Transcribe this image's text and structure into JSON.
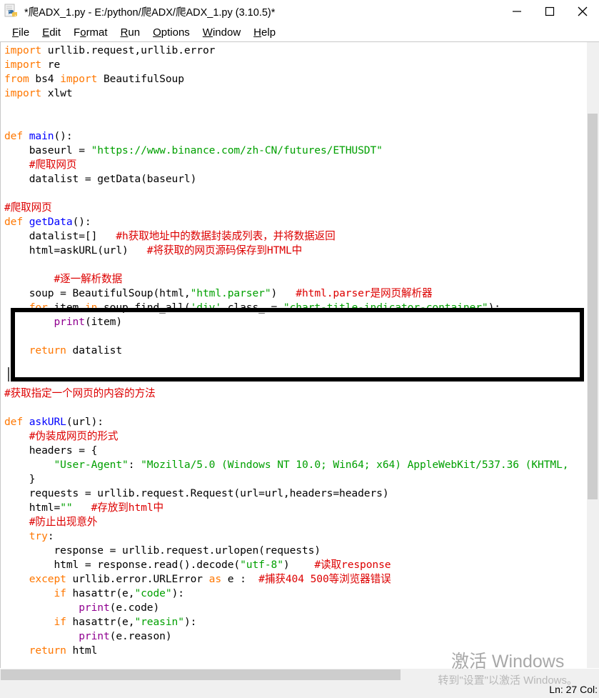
{
  "window": {
    "title": "*爬ADX_1.py - E:/python/爬ADX/爬ADX_1.py (3.10.5)*",
    "icon": "python-file-icon",
    "controls": {
      "minimize": "—",
      "maximize": "□",
      "close": "✕"
    }
  },
  "menubar": {
    "items": [
      {
        "mnemonic": "F",
        "rest": "ile"
      },
      {
        "mnemonic": "E",
        "rest": "dit"
      },
      {
        "pre": "F",
        "mnemonic": "o",
        "rest": "rmat"
      },
      {
        "mnemonic": "R",
        "rest": "un"
      },
      {
        "mnemonic": "O",
        "rest": "ptions"
      },
      {
        "mnemonic": "W",
        "rest": "indow"
      },
      {
        "mnemonic": "H",
        "rest": "elp"
      }
    ]
  },
  "editor": {
    "lines": [
      [
        {
          "t": "import",
          "c": "kw"
        },
        {
          "t": " urllib.request,urllib.error",
          "c": "pl"
        }
      ],
      [
        {
          "t": "import",
          "c": "kw"
        },
        {
          "t": " re",
          "c": "pl"
        }
      ],
      [
        {
          "t": "from",
          "c": "kw"
        },
        {
          "t": " bs4 ",
          "c": "pl"
        },
        {
          "t": "import",
          "c": "kw"
        },
        {
          "t": " BeautifulSoup",
          "c": "pl"
        }
      ],
      [
        {
          "t": "import",
          "c": "kw"
        },
        {
          "t": " xlwt",
          "c": "pl"
        }
      ],
      [],
      [],
      [
        {
          "t": "def",
          "c": "kw"
        },
        {
          "t": " ",
          "c": "pl"
        },
        {
          "t": "main",
          "c": "fn"
        },
        {
          "t": "():",
          "c": "pl"
        }
      ],
      [
        {
          "t": "    baseurl = ",
          "c": "pl"
        },
        {
          "t": "\"https://www.binance.com/zh-CN/futures/ETHUSDT\"",
          "c": "str"
        }
      ],
      [
        {
          "t": "    ",
          "c": "pl"
        },
        {
          "t": "#爬取网页",
          "c": "cmt"
        }
      ],
      [
        {
          "t": "    datalist = getData(baseurl)",
          "c": "pl"
        }
      ],
      [],
      [
        {
          "t": "#爬取网页",
          "c": "cmt"
        }
      ],
      [
        {
          "t": "def",
          "c": "kw"
        },
        {
          "t": " ",
          "c": "pl"
        },
        {
          "t": "getData",
          "c": "fn"
        },
        {
          "t": "():",
          "c": "pl"
        }
      ],
      [
        {
          "t": "    datalist=[]   ",
          "c": "pl"
        },
        {
          "t": "#h获取地址中的数据封装成列表，并将数据返回",
          "c": "cmt"
        }
      ],
      [
        {
          "t": "    html=askURL(url)   ",
          "c": "pl"
        },
        {
          "t": "#将获取的网页源码保存到HTML中",
          "c": "cmt"
        }
      ],
      [],
      [
        {
          "t": "        ",
          "c": "pl"
        },
        {
          "t": "#逐一解析数据",
          "c": "cmt"
        }
      ],
      [
        {
          "t": "    soup = BeautifulSoup(html,",
          "c": "pl"
        },
        {
          "t": "\"html.parser\"",
          "c": "str"
        },
        {
          "t": ")   ",
          "c": "pl"
        },
        {
          "t": "#html.parser是网页解析器",
          "c": "cmt"
        }
      ],
      [
        {
          "t": "    ",
          "c": "pl"
        },
        {
          "t": "for",
          "c": "kw"
        },
        {
          "t": " item ",
          "c": "pl"
        },
        {
          "t": "in",
          "c": "kw"
        },
        {
          "t": " soup.find_all(",
          "c": "pl"
        },
        {
          "t": "'div'",
          "c": "str"
        },
        {
          "t": ",class_ = ",
          "c": "pl"
        },
        {
          "t": "\"chart-title-indicator-container\"",
          "c": "str"
        },
        {
          "t": "):",
          "c": "pl"
        }
      ],
      [
        {
          "t": "        ",
          "c": "pl"
        },
        {
          "t": "print",
          "c": "bi"
        },
        {
          "t": "(item)",
          "c": "pl"
        }
      ],
      [],
      [
        {
          "t": "    ",
          "c": "pl"
        },
        {
          "t": "return",
          "c": "kw"
        },
        {
          "t": " datalist",
          "c": "pl"
        }
      ],
      [],
      [],
      [
        {
          "t": "#获取指定一个网页的内容的方法",
          "c": "cmt"
        }
      ],
      [],
      [
        {
          "t": "def",
          "c": "kw"
        },
        {
          "t": " ",
          "c": "pl"
        },
        {
          "t": "askURL",
          "c": "fn"
        },
        {
          "t": "(url):",
          "c": "pl"
        }
      ],
      [
        {
          "t": "    ",
          "c": "pl"
        },
        {
          "t": "#伪装成网页的形式",
          "c": "cmt"
        }
      ],
      [
        {
          "t": "    headers = {",
          "c": "pl"
        }
      ],
      [
        {
          "t": "        ",
          "c": "pl"
        },
        {
          "t": "\"User-Agent\"",
          "c": "str"
        },
        {
          "t": ": ",
          "c": "pl"
        },
        {
          "t": "\"Mozilla/5.0 (Windows NT 10.0; Win64; x64) AppleWebKit/537.36 (KHTML,",
          "c": "str"
        }
      ],
      [
        {
          "t": "    }",
          "c": "pl"
        }
      ],
      [
        {
          "t": "    requests = urllib.request.Request(url=url,headers=headers)",
          "c": "pl"
        }
      ],
      [
        {
          "t": "    html=",
          "c": "pl"
        },
        {
          "t": "\"\"",
          "c": "str"
        },
        {
          "t": "   ",
          "c": "pl"
        },
        {
          "t": "#存放到html中",
          "c": "cmt"
        }
      ],
      [
        {
          "t": "    ",
          "c": "pl"
        },
        {
          "t": "#防止出现意外",
          "c": "cmt"
        }
      ],
      [
        {
          "t": "    ",
          "c": "pl"
        },
        {
          "t": "try",
          "c": "kw"
        },
        {
          "t": ":",
          "c": "pl"
        }
      ],
      [
        {
          "t": "        response = urllib.request.urlopen(requests)",
          "c": "pl"
        }
      ],
      [
        {
          "t": "        html = response.read().decode(",
          "c": "pl"
        },
        {
          "t": "\"utf-8\"",
          "c": "str"
        },
        {
          "t": ")    ",
          "c": "pl"
        },
        {
          "t": "#读取response",
          "c": "cmt"
        }
      ],
      [
        {
          "t": "    ",
          "c": "pl"
        },
        {
          "t": "except",
          "c": "kw"
        },
        {
          "t": " urllib.error.URLError ",
          "c": "pl"
        },
        {
          "t": "as",
          "c": "kw"
        },
        {
          "t": " e :  ",
          "c": "pl"
        },
        {
          "t": "#捕获404 500等浏览器错误",
          "c": "cmt"
        }
      ],
      [
        {
          "t": "        ",
          "c": "pl"
        },
        {
          "t": "if",
          "c": "kw"
        },
        {
          "t": " hasattr(e,",
          "c": "pl"
        },
        {
          "t": "\"code\"",
          "c": "str"
        },
        {
          "t": "):",
          "c": "pl"
        }
      ],
      [
        {
          "t": "            ",
          "c": "pl"
        },
        {
          "t": "print",
          "c": "bi"
        },
        {
          "t": "(e.code)",
          "c": "pl"
        }
      ],
      [
        {
          "t": "        ",
          "c": "pl"
        },
        {
          "t": "if",
          "c": "kw"
        },
        {
          "t": " hasattr(e,",
          "c": "pl"
        },
        {
          "t": "\"reasin\"",
          "c": "str"
        },
        {
          "t": "):",
          "c": "pl"
        }
      ],
      [
        {
          "t": "            ",
          "c": "pl"
        },
        {
          "t": "print",
          "c": "bi"
        },
        {
          "t": "(e.reason)",
          "c": "pl"
        }
      ],
      [
        {
          "t": "    ",
          "c": "pl"
        },
        {
          "t": "return",
          "c": "kw"
        },
        {
          "t": " html",
          "c": "pl"
        }
      ]
    ]
  },
  "statusbar": {
    "text": "Ln: 27  Col:"
  },
  "watermark": {
    "line1": "激活 Windows",
    "line2": "转到\"设置\"以激活 Windows。"
  },
  "colors": {
    "keyword": "#ff7700",
    "function": "#0000ff",
    "string": "#00a000",
    "comment": "#dd0000",
    "builtin": "#900090",
    "highlight_box": "#000000"
  }
}
